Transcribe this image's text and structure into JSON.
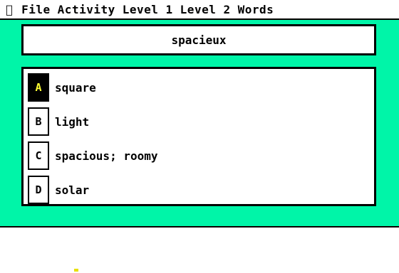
{
  "menubar": {
    "apple_icon": "",
    "items": [
      "File",
      "Activity",
      "Level 1",
      "Level 2",
      "Words"
    ]
  },
  "prompt_word": "spacieux",
  "choices": [
    {
      "letter": "A",
      "text": "square",
      "selected": true
    },
    {
      "letter": "B",
      "text": "light",
      "selected": false
    },
    {
      "letter": "C",
      "text": "spacious; roomy",
      "selected": false
    },
    {
      "letter": "D",
      "text": "solar",
      "selected": false
    }
  ],
  "colors": {
    "background_green": "#00f5a8",
    "selected_letter_bg": "#000000",
    "selected_letter_fg": "#ffff33"
  }
}
